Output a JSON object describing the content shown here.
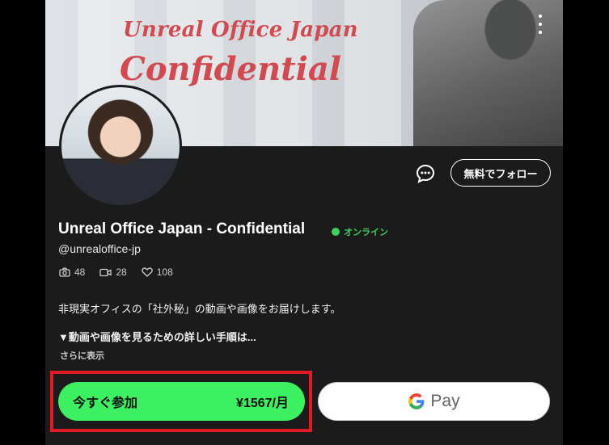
{
  "banner": {
    "title_line1": "Unreal Office Japan",
    "title_line2": "Confidential"
  },
  "profile": {
    "name": "Unreal Office Japan - Confidential",
    "status": "オンライン",
    "handle": "@unrealoffice-jp",
    "stats": {
      "photos": "48",
      "videos": "28",
      "likes": "108"
    },
    "description_line1": "非現実オフィスの「社外秘」の動画や画像をお届けします。",
    "description_line2": "▼動画や画像を見るための詳しい手順は...",
    "show_more": "さらに表示"
  },
  "actions": {
    "follow_label": "無料でフォロー",
    "join_label": "今すぐ参加",
    "join_price": "¥1567/月",
    "gpay_text": "Pay"
  },
  "colors": {
    "accent_green": "#3df061",
    "online_green": "#3ed15f",
    "highlight_red": "#e01b24",
    "banner_text": "#d04a4f"
  }
}
